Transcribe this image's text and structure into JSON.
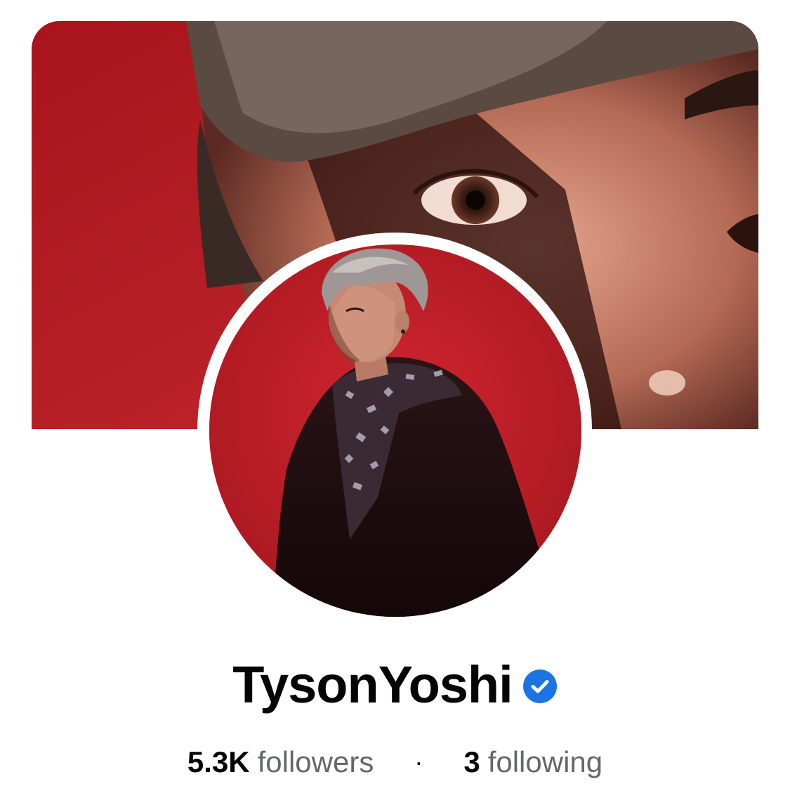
{
  "profile": {
    "name": "TysonYoshi",
    "verified": true,
    "verified_color": "#1b74e4",
    "followers_count": "5.3K",
    "followers_label": "followers",
    "separator": "·",
    "following_count": "3",
    "following_label": "following"
  },
  "icons": {
    "verified": "verified-check-badge-icon"
  },
  "colors": {
    "cover_background": "#b51f26",
    "avatar_background": "#c9222c",
    "name_text": "#050505",
    "secondary_text": "#65676b"
  }
}
